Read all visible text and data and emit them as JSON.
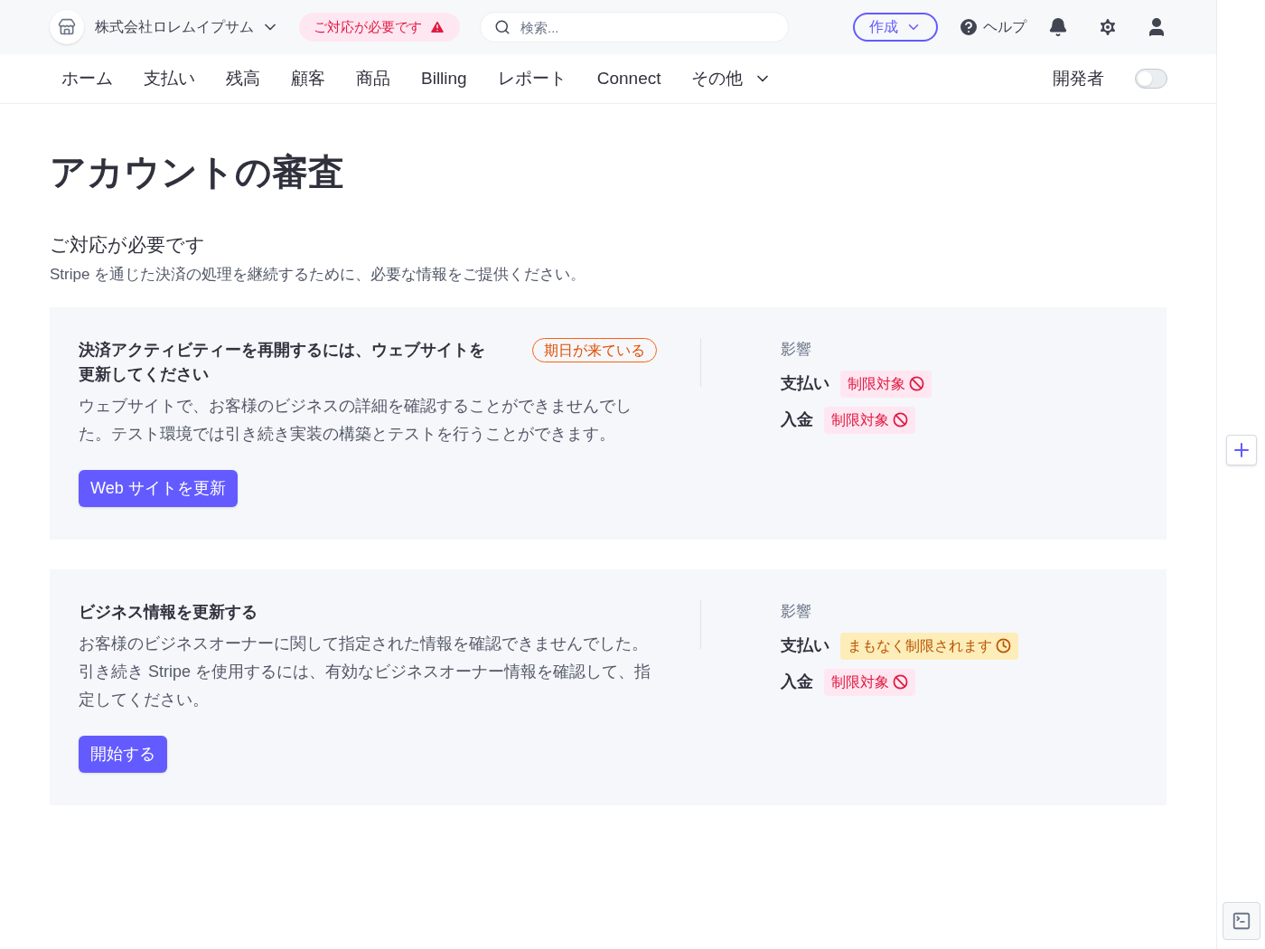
{
  "header": {
    "account_name": "株式会社ロレムイプサム",
    "alert_badge": "ご対応が必要です",
    "search": {
      "placeholder": "検索..."
    },
    "create_button": "作成",
    "help_label": "ヘルプ"
  },
  "nav": {
    "items": [
      "ホーム",
      "支払い",
      "残高",
      "顧客",
      "商品",
      "Billing",
      "レポート",
      "Connect"
    ],
    "more": "その他",
    "developer_label": "開発者",
    "developer_mode": {
      "on": false
    }
  },
  "page_title": "アカウントの審査",
  "section": {
    "title": "ご対応が必要です",
    "description": "Stripe を通じた決済の処理を継続するために、必要な情報をご提供ください。"
  },
  "tasks": [
    {
      "title": "決済アクティビティーを再開するには、ウェブサイトを更新してください",
      "badge": "期日が来ている",
      "description": "ウェブサイトで、お客様のビジネスの詳細を確認することができませんでした。テスト環境では引き続き実装の構築とテストを行うことができます。",
      "button": "Web サイトを更新",
      "impact_label": "影響",
      "impacts": [
        {
          "label": "支払い",
          "status": "制限対象",
          "kind": "restricted"
        },
        {
          "label": "入金",
          "status": "制限対象",
          "kind": "restricted"
        }
      ]
    },
    {
      "title": "ビジネス情報を更新する",
      "description": "お客様のビジネスオーナーに関して指定された情報を確認できませんでした。引き続き Stripe を使用するには、有効なビジネスオーナー情報を確認して、指定してください。",
      "button": "開始する",
      "impact_label": "影響",
      "impacts": [
        {
          "label": "支払い",
          "status": "まもなく制限されます",
          "kind": "pending"
        },
        {
          "label": "入金",
          "status": "制限対象",
          "kind": "restricted"
        }
      ]
    }
  ]
}
